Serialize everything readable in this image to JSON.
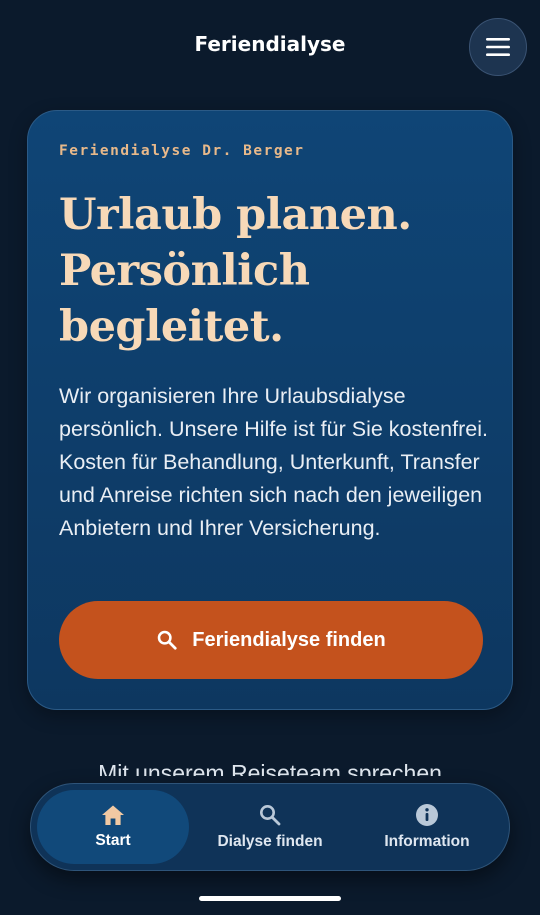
{
  "header": {
    "title": "Feriendialyse",
    "menu_icon": "hamburger-menu-icon"
  },
  "hero": {
    "eyebrow": "Feriendialyse Dr. Berger",
    "headline_lines": [
      "Urlaub planen.",
      "Persönlich",
      "begleitet."
    ],
    "body": "Wir organisieren Ihre Urlaubsdialyse persönlich. Unsere Hilfe ist für Sie kostenfrei. Kosten für Behandlung, Unterkunft, Transfer und Anreise richten sich nach den jeweiligen Anbietern und Ihrer Versicherung.",
    "cta_label": "Feriendialyse finden",
    "cta_icon": "search-icon"
  },
  "below_fold_text": "Mit unserem Reiseteam sprechen",
  "bottom_nav": {
    "items": [
      {
        "label": "Start",
        "icon": "home-icon",
        "active": true
      },
      {
        "label": "Dialyse finden",
        "icon": "search-icon",
        "active": false
      },
      {
        "label": "Information",
        "icon": "info-icon",
        "active": false
      }
    ]
  },
  "colors": {
    "background": "#0b1a2c",
    "card": "#0f4576",
    "accent": "#c4521d",
    "headline": "#f7d9b8",
    "eyebrow": "#e8b98a"
  }
}
